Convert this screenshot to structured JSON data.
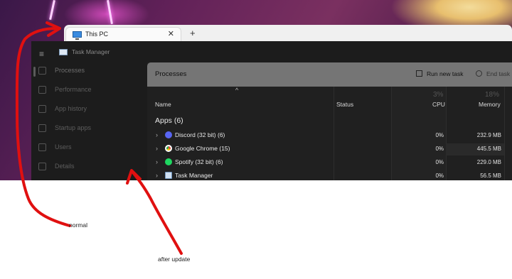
{
  "explorer": {
    "tab_title": "This PC",
    "close_glyph": "✕",
    "add_glyph": "+"
  },
  "task_manager": {
    "title": "Task Manager",
    "menu_glyph": "≡",
    "nav": [
      {
        "label": "Processes",
        "icon": "processes-icon"
      },
      {
        "label": "Performance",
        "icon": "performance-icon"
      },
      {
        "label": "App history",
        "icon": "app-history-icon"
      },
      {
        "label": "Startup apps",
        "icon": "startup-apps-icon"
      },
      {
        "label": "Users",
        "icon": "users-icon"
      },
      {
        "label": "Details",
        "icon": "details-icon"
      }
    ],
    "panel_title": "Processes",
    "run_new_task": "Run new task",
    "end_task": "End task",
    "columns": {
      "name": "Name",
      "status": "Status",
      "cpu": "CPU",
      "cpu_pct": "3%",
      "memory": "Memory",
      "memory_pct": "18%",
      "sort_glyph": "^"
    },
    "group_label": "Apps (6)",
    "rows": [
      {
        "name": "Discord (32 bit) (6)",
        "cpu": "0%",
        "memory": "232.9 MB",
        "icon": "discord-icon",
        "color": "#5865F2"
      },
      {
        "name": "Google Chrome (15)",
        "cpu": "0%",
        "memory": "445.5 MB",
        "icon": "chrome-icon",
        "color": "#e0463a"
      },
      {
        "name": "Spotify (32 bit) (6)",
        "cpu": "0%",
        "memory": "229.0 MB",
        "icon": "spotify-icon",
        "color": "#1ed760"
      },
      {
        "name": "Task Manager",
        "cpu": "0%",
        "memory": "56.5 MB",
        "icon": "task-manager-icon",
        "color": "#8fb4d9"
      }
    ]
  },
  "annotations": {
    "normal": "normal",
    "after_update": "after update"
  },
  "colors": {
    "annotation_red": "#e01010"
  }
}
